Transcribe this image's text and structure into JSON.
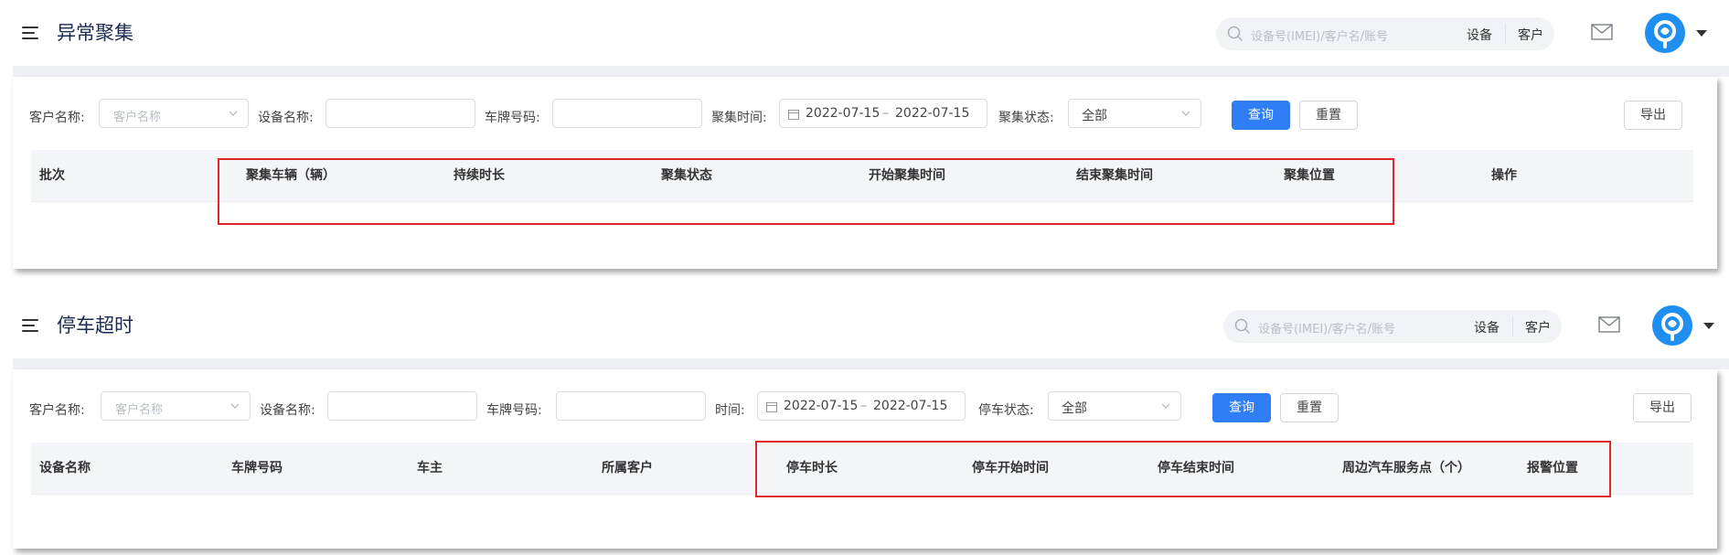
{
  "header": {
    "search_placeholder": "设备号(IMEI)/客户名/账号",
    "search_tab_device": "设备",
    "search_tab_customer": "客户"
  },
  "screens": [
    {
      "title": "异常聚集",
      "filters": {
        "customer_label": "客户名称:",
        "customer_placeholder": "客户名称",
        "device_label": "设备名称:",
        "device_value": "",
        "plate_label": "车牌号码:",
        "plate_value": "",
        "time_label": "聚集时间:",
        "date_start": "2022-07-15",
        "date_sep": "–",
        "date_end": "2022-07-15",
        "status_label": "聚集状态:",
        "status_value": "全部"
      },
      "buttons": {
        "query": "查询",
        "reset": "重置",
        "export": "导出"
      },
      "columns": [
        "批次",
        "聚集车辆（辆）",
        "持续时长",
        "聚集状态",
        "开始聚集时间",
        "结束聚集时间",
        "聚集位置",
        "操作"
      ],
      "rows": []
    },
    {
      "title": "停车超时",
      "filters": {
        "customer_label": "客户名称:",
        "customer_placeholder": "客户名称",
        "device_label": "设备名称:",
        "device_value": "",
        "plate_label": "车牌号码:",
        "plate_value": "",
        "time_label": "时间:",
        "date_start": "2022-07-15",
        "date_sep": "–",
        "date_end": "2022-07-15",
        "status_label": "停车状态:",
        "status_value": "全部"
      },
      "buttons": {
        "query": "查询",
        "reset": "重置",
        "export": "导出"
      },
      "columns": [
        "设备名称",
        "车牌号码",
        "车主",
        "所属客户",
        "停车时长",
        "停车开始时间",
        "停车结束时间",
        "周边汽车服务点（个）",
        "报警位置"
      ],
      "rows": []
    }
  ],
  "colors": {
    "primary": "#2f7ef5",
    "avatar": "#1e8ef0",
    "highlight_box": "#e0262b",
    "table_header_bg": "#f4f5f8"
  },
  "icons": [
    "menu-icon",
    "search-icon",
    "mail-icon",
    "avatar-logo-icon",
    "caret-down-icon",
    "chevron-down-icon",
    "calendar-icon"
  ]
}
